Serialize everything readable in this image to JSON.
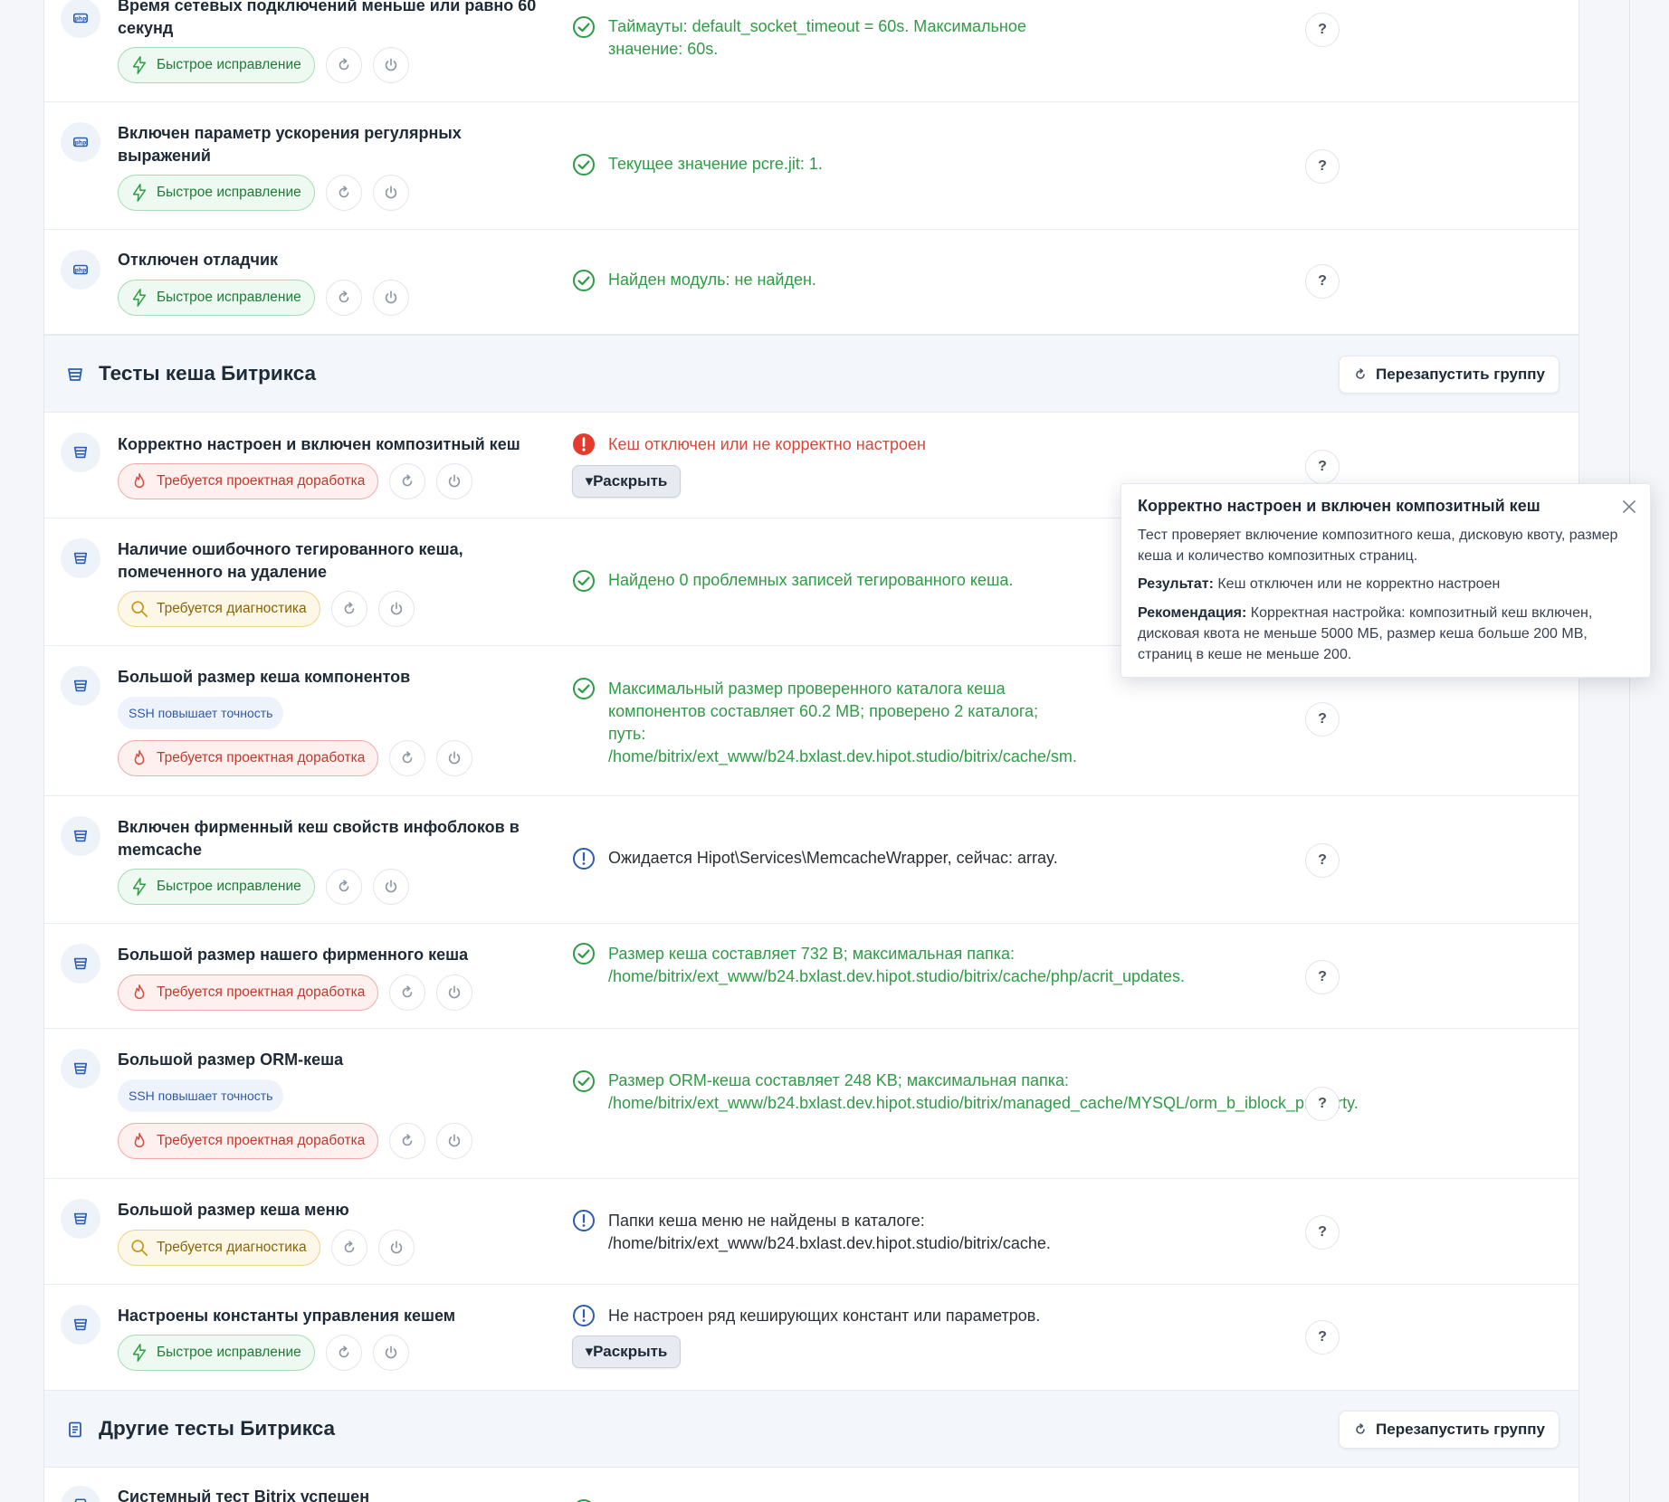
{
  "colors": {
    "ok": "#2e9c45",
    "error": "#d9473b",
    "info": "#2b5db3",
    "quick_fix": "#1f7a36",
    "project": "#c0392b",
    "diagnostics": "#8a6406"
  },
  "labels": {
    "quick_fix": "Быстрое исправление",
    "project": "Требуется проектная доработка",
    "diagnostics": "Требуется диагностика",
    "ssh": "SSH повышает точность",
    "expand": "▾Раскрыть",
    "restart_group": "Перезапустить группу",
    "help": "?"
  },
  "rows_top": [
    {
      "title": "Время сетевых подключений меньше или равно 60 секунд",
      "result": "Таймауты: default_socket_timeout = 60s. Максимальное значение: 60s."
    },
    {
      "title": "Включен параметр ускорения регулярных выражений",
      "result": "Текущее значение pcre.jit: 1."
    },
    {
      "title": "Отключен отладчик",
      "result": "Найден модуль: не найден."
    }
  ],
  "group_cache": {
    "title": "Тесты кеша Битрикса",
    "rows": [
      {
        "title": "Корректно настроен и включен композитный кеш",
        "result": "Кеш отключен или не корректно настроен"
      },
      {
        "title": "Наличие ошибочного тегированного кеша, помеченного на удаление",
        "result": "Найдено 0 проблемных записей тегированного кеша."
      },
      {
        "title": "Большой размер кеша компонентов",
        "result": "Максимальный размер проверенного каталога кеша компонентов составляет 60.2 MB; проверено 2 каталога; путь: /home/bitrix/ext_www/b24.bxlast.dev.hipot.studio/bitrix/cache/sm."
      },
      {
        "title": "Включен фирменный кеш свойств инфоблоков в memcache",
        "result": "Ожидается Hipot\\Services\\MemcacheWrapper, сейчас: array."
      },
      {
        "title": "Большой размер нашего фирменного кеша",
        "result": "Размер кеша составляет 732 B; максимальная папка: /home/bitrix/ext_www/b24.bxlast.dev.hipot.studio/bitrix/cache/php/acrit_updates."
      },
      {
        "title": "Большой размер ORM-кеша",
        "result": "Размер ORM-кеша составляет 248 KB; максимальная папка: /home/bitrix/ext_www/b24.bxlast.dev.hipot.studio/bitrix/managed_cache/MYSQL/orm_b_iblock_property."
      },
      {
        "title": "Большой размер кеша меню",
        "result": "Папки кеша меню не найдены в каталоге: /home/bitrix/ext_www/b24.bxlast.dev.hipot.studio/bitrix/cache."
      },
      {
        "title": "Настроены константы управления кешем",
        "result": "Не настроен ряд кеширующих констант или параметров."
      }
    ]
  },
  "group_other": {
    "title": "Другие тесты Битрикса",
    "rows": [
      {
        "title": "Системный тест Bitrix успешен"
      }
    ]
  },
  "tooltip": {
    "title": "Корректно настроен и включен композитный кеш",
    "description": "Тест проверяет включение композитного кеша, дисковую квоту, размер кеша и количество композитных страниц.",
    "result_label": "Результат:",
    "result_text": "Кеш отключен или не корректно настроен",
    "recommendation_label": "Рекомендация:",
    "recommendation_text": "Корректная настройка: композитный кеш включен, дисковая квота не меньше 5000 МБ, размер кеша больше 200 MB, страниц в кеше не меньше 200."
  }
}
